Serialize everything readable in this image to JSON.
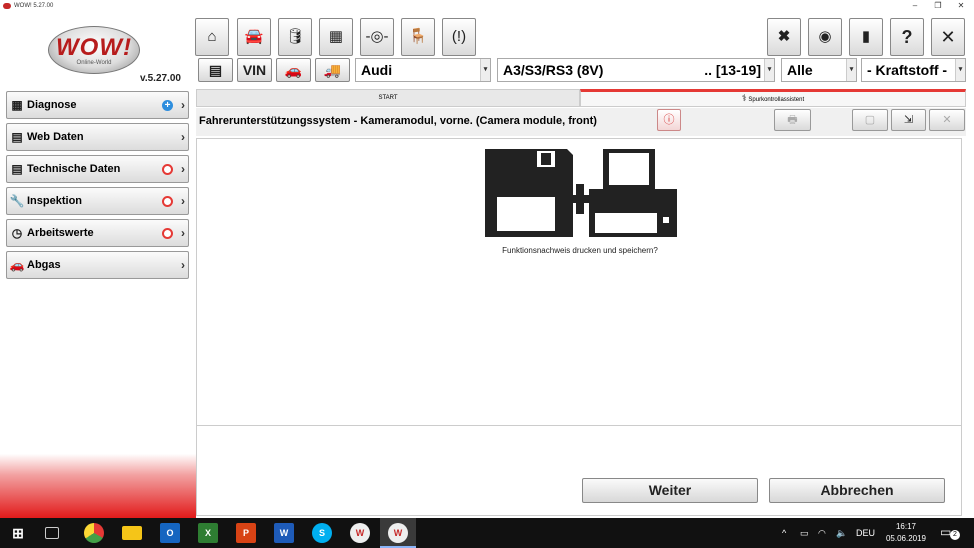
{
  "window": {
    "title": "WOW! 5.27.00",
    "min": "–",
    "max": "❐",
    "close": "✕"
  },
  "logo": {
    "text": "WOW!",
    "subtext": "Online-World"
  },
  "version": "v.5.27.00",
  "nav": [
    {
      "label": "Diagnose",
      "icon": "diagnose-icon",
      "glyph": "▦",
      "badge": "plus",
      "badge_glyph": "+"
    },
    {
      "label": "Web Daten",
      "icon": "web-data-icon",
      "glyph": "▤",
      "badge": "",
      "badge_glyph": ""
    },
    {
      "label": "Technische Daten",
      "icon": "tech-data-icon",
      "glyph": "▤",
      "badge": "octagon",
      "badge_glyph": ""
    },
    {
      "label": "Inspektion",
      "icon": "wrench-icon",
      "glyph": "🔧",
      "badge": "octagon",
      "badge_glyph": ""
    },
    {
      "label": "Arbeitswerte",
      "icon": "clock-icon",
      "glyph": "◷",
      "badge": "octagon",
      "badge_glyph": ""
    },
    {
      "label": "Abgas",
      "icon": "exhaust-icon",
      "glyph": "🚗",
      "badge": "",
      "badge_glyph": ""
    }
  ],
  "nav_arrow": "›",
  "toolbar": {
    "home": "⌂",
    "car_diag": "🚘",
    "oil": "🛢",
    "battery": "▦",
    "sensor": "-◎-",
    "seat": "🪑",
    "tpms": "(!)",
    "tools": "✖",
    "connect": "◉",
    "manual": "▮",
    "help": "?",
    "close": "✕",
    "filter": "▤",
    "vin": "VIN",
    "car": "🚗",
    "truck": "🚚"
  },
  "vehicle": {
    "make": "Audi",
    "model": "A3/S3/RS3 (8V)",
    "years": ".. [13-19]",
    "engine": "Alle",
    "fuel": "- Kraftstoff -"
  },
  "dropdown_glyph": "▾",
  "tabs": {
    "start": "START",
    "active": "Spurkontrollassistent"
  },
  "header": {
    "title": "Fahrerunterstützungssystem - Kameramodul, vorne. (Camera module, front)",
    "info_glyph": "ⓘ",
    "print_glyph": "🖶",
    "save_glyph": "▢",
    "expand_glyph": "⇲",
    "cancel_glyph": "✕"
  },
  "content": {
    "prompt": "Funktionsnachweis drucken und speichern?"
  },
  "buttons": {
    "next": "Weiter",
    "cancel": "Abbrechen"
  },
  "taskbar": {
    "apps": [
      "start-icon",
      "task-view-icon",
      "chrome-icon",
      "explorer-icon",
      "outlook-icon",
      "excel-icon",
      "powerpoint-icon",
      "word-icon",
      "skype-icon",
      "wow-icon",
      "wow-active-icon"
    ],
    "tray_lang": "DEU",
    "time": "16:17",
    "date": "05.06.2019",
    "notifications": "2"
  }
}
